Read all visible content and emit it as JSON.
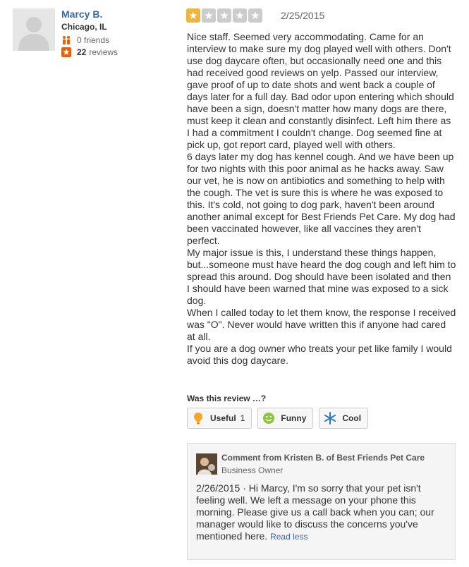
{
  "user": {
    "name": "Marcy B.",
    "location": "Chicago, IL",
    "friends": "0 friends",
    "reviews_count": "22",
    "reviews_label": "reviews"
  },
  "review": {
    "rating": 1,
    "max_rating": 5,
    "date": "2/25/2015",
    "text": "Nice staff.  Seemed very accommodating. Came for an interview to make sure my dog played well with others. Don't use dog daycare often, but occasionally need one and this had received good reviews on yelp. Passed our interview, gave proof of up to date shots and went back a couple of days later for a full day. Bad odor upon entering which should have been a sign, doesn't matter how many dogs are there, must keep it clean and constantly disinfect. Left him there as I had a commitment I couldn't change. Dog seemed fine at pick up, got report card, played well with others.\n6 days later my dog has kennel cough. And we have been up for two nights with this poor animal as he hacks away. Saw our vet, he is now on antibiotics and something to help with the cough. The vet is sure this is where he was exposed to this. It's cold, not going to dog park, haven't been around another animal except for Best Friends Pet Care. My dog had been vaccinated however, like all vaccines they aren't perfect.\nMy major issue is this, I understand these things happen, but...someone must have heard the dog cough and left him to spread this around. Dog should have been isolated and then I should have been warned that mine was exposed to a sick dog.\nWhen I called today to let them know, the response I received was \"O\".  Never would have written this if anyone had cared at all.\nIf you are a dog owner who treats your pet like family I would avoid this dog daycare."
  },
  "votes": {
    "prompt": "Was this review …?",
    "useful_label": "Useful",
    "useful_count": "1",
    "funny_label": "Funny",
    "cool_label": "Cool"
  },
  "comment": {
    "title": "Comment from Kristen B. of Best Friends Pet Care",
    "role": "Business Owner",
    "date": "2/26/2015",
    "separator": "·",
    "text": "Hi Marcy, I'm so sorry that your pet isn't feeling well. We left a message on your phone this morning. Please give us a call back when you can; our manager would like to discuss the concerns you've mentioned here.",
    "read_less": "Read less"
  },
  "colors": {
    "star_filled": "#f0b43b",
    "star_empty": "#cccccc",
    "link": "#3b65a7"
  }
}
